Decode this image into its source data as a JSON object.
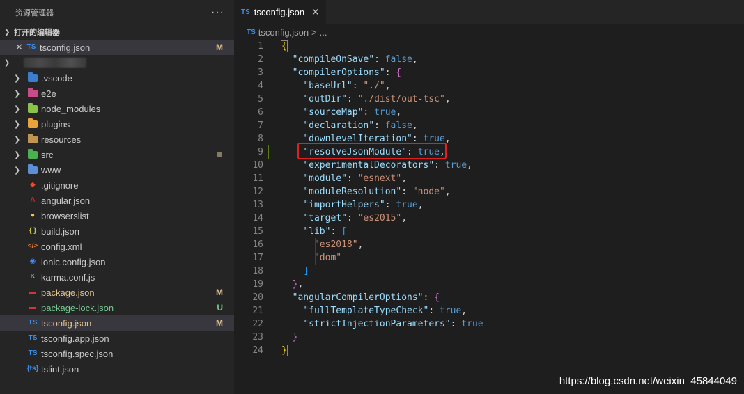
{
  "sidebar": {
    "title": "资源管理器",
    "more": "···",
    "open_editors_title": "打开的编辑器",
    "open_editors": [
      {
        "close": "✕",
        "name": "tsconfig.json",
        "status": "M"
      }
    ],
    "tree": [
      {
        "name": ".vscode",
        "type": "folder",
        "icon_color": "#3c7dd0"
      },
      {
        "name": "e2e",
        "type": "folder",
        "icon_color": "#c94c8a"
      },
      {
        "name": "node_modules",
        "type": "folder",
        "icon_color": "#8bc34a"
      },
      {
        "name": "plugins",
        "type": "folder",
        "icon_color": "#e8a33a"
      },
      {
        "name": "resources",
        "type": "folder",
        "icon_color": "#c09553"
      },
      {
        "name": "src",
        "type": "folder",
        "icon_color": "#4caf50"
      },
      {
        "name": "www",
        "type": "folder",
        "icon_color": "#5c8fd6"
      },
      {
        "name": ".gitignore",
        "type": "file",
        "icon": "git-icon",
        "glyph": "◆",
        "icon_color": "#e44d2e"
      },
      {
        "name": "angular.json",
        "type": "file",
        "icon": "angular-icon",
        "glyph": "A",
        "icon_color": "#dd1b16"
      },
      {
        "name": "browserslist",
        "type": "file",
        "icon": "browserslist-icon",
        "glyph": "●",
        "icon_color": "#f7c948"
      },
      {
        "name": "build.json",
        "type": "file",
        "icon": "json-icon",
        "glyph": "{ }",
        "icon_color": "#cbcb41"
      },
      {
        "name": "config.xml",
        "type": "file",
        "icon": "xml-icon",
        "glyph": "</>",
        "icon_color": "#e37933"
      },
      {
        "name": "ionic.config.json",
        "type": "file",
        "icon": "ionic-icon",
        "glyph": "◉",
        "icon_color": "#4b8bf4"
      },
      {
        "name": "karma.conf.js",
        "type": "file",
        "icon": "karma-icon",
        "glyph": "K",
        "icon_color": "#56c3b6"
      },
      {
        "name": "package.json",
        "type": "file",
        "icon": "npm-icon",
        "glyph": "▬",
        "icon_color": "#cb3837",
        "status": "M"
      },
      {
        "name": "package-lock.json",
        "type": "file",
        "icon": "npm-icon",
        "glyph": "▬",
        "icon_color": "#cb3837",
        "status": "U"
      },
      {
        "name": "tsconfig.json",
        "type": "file",
        "icon": "tsconfig-icon",
        "glyph": "TS",
        "icon_color": "#3b8eea",
        "status": "M",
        "selected": true
      },
      {
        "name": "tsconfig.app.json",
        "type": "file",
        "icon": "tsconfig-icon",
        "glyph": "TS",
        "icon_color": "#3b8eea"
      },
      {
        "name": "tsconfig.spec.json",
        "type": "file",
        "icon": "tsconfig-icon",
        "glyph": "TS",
        "icon_color": "#3b8eea"
      },
      {
        "name": "tslint.json",
        "type": "file",
        "icon": "tslint-icon",
        "glyph": "{ts}",
        "icon_color": "#3b8eea"
      }
    ]
  },
  "editor": {
    "tab": {
      "label": "tsconfig.json",
      "close": "✕",
      "icon": "TS"
    },
    "breadcrumb": {
      "file": "tsconfig.json",
      "sep": ">",
      "rest": "..."
    },
    "lines": [
      {
        "n": "1",
        "t": [
          [
            "br1",
            "{"
          ]
        ]
      },
      {
        "n": "2",
        "t": [
          [
            "p",
            "  "
          ],
          [
            "k",
            "\"compileOnSave\""
          ],
          [
            "p",
            ": "
          ],
          [
            "b",
            "false"
          ],
          [
            "p",
            ","
          ]
        ]
      },
      {
        "n": "3",
        "t": [
          [
            "p",
            "  "
          ],
          [
            "k",
            "\"compilerOptions\""
          ],
          [
            "p",
            ": "
          ],
          [
            "br2",
            "{"
          ]
        ]
      },
      {
        "n": "4",
        "t": [
          [
            "p",
            "    "
          ],
          [
            "k",
            "\"baseUrl\""
          ],
          [
            "p",
            ": "
          ],
          [
            "s",
            "\"./\""
          ],
          [
            "p",
            ","
          ]
        ]
      },
      {
        "n": "5",
        "t": [
          [
            "p",
            "    "
          ],
          [
            "k",
            "\"outDir\""
          ],
          [
            "p",
            ": "
          ],
          [
            "s",
            "\"./dist/out-tsc\""
          ],
          [
            "p",
            ","
          ]
        ]
      },
      {
        "n": "6",
        "t": [
          [
            "p",
            "    "
          ],
          [
            "k",
            "\"sourceMap\""
          ],
          [
            "p",
            ": "
          ],
          [
            "b",
            "true"
          ],
          [
            "p",
            ","
          ]
        ]
      },
      {
        "n": "7",
        "t": [
          [
            "p",
            "    "
          ],
          [
            "k",
            "\"declaration\""
          ],
          [
            "p",
            ": "
          ],
          [
            "b",
            "false"
          ],
          [
            "p",
            ","
          ]
        ]
      },
      {
        "n": "8",
        "t": [
          [
            "p",
            "    "
          ],
          [
            "k",
            "\"downlevelIteration\""
          ],
          [
            "p",
            ": "
          ],
          [
            "b",
            "true"
          ],
          [
            "p",
            ","
          ]
        ]
      },
      {
        "n": "9",
        "t": [
          [
            "p",
            "    "
          ],
          [
            "k",
            "\"resolveJsonModule\""
          ],
          [
            "p",
            ": "
          ],
          [
            "b",
            "true"
          ],
          [
            "p",
            ","
          ]
        ]
      },
      {
        "n": "10",
        "t": [
          [
            "p",
            "    "
          ],
          [
            "k",
            "\"experimentalDecorators\""
          ],
          [
            "p",
            ": "
          ],
          [
            "b",
            "true"
          ],
          [
            "p",
            ","
          ]
        ]
      },
      {
        "n": "11",
        "t": [
          [
            "p",
            "    "
          ],
          [
            "k",
            "\"module\""
          ],
          [
            "p",
            ": "
          ],
          [
            "s",
            "\"esnext\""
          ],
          [
            "p",
            ","
          ]
        ]
      },
      {
        "n": "12",
        "t": [
          [
            "p",
            "    "
          ],
          [
            "k",
            "\"moduleResolution\""
          ],
          [
            "p",
            ": "
          ],
          [
            "s",
            "\"node\""
          ],
          [
            "p",
            ","
          ]
        ]
      },
      {
        "n": "13",
        "t": [
          [
            "p",
            "    "
          ],
          [
            "k",
            "\"importHelpers\""
          ],
          [
            "p",
            ": "
          ],
          [
            "b",
            "true"
          ],
          [
            "p",
            ","
          ]
        ]
      },
      {
        "n": "14",
        "t": [
          [
            "p",
            "    "
          ],
          [
            "k",
            "\"target\""
          ],
          [
            "p",
            ": "
          ],
          [
            "s",
            "\"es2015\""
          ],
          [
            "p",
            ","
          ]
        ]
      },
      {
        "n": "15",
        "t": [
          [
            "p",
            "    "
          ],
          [
            "k",
            "\"lib\""
          ],
          [
            "p",
            ": "
          ],
          [
            "br3",
            "["
          ]
        ]
      },
      {
        "n": "16",
        "t": [
          [
            "p",
            "      "
          ],
          [
            "s",
            "\"es2018\""
          ],
          [
            "p",
            ","
          ]
        ]
      },
      {
        "n": "17",
        "t": [
          [
            "p",
            "      "
          ],
          [
            "s",
            "\"dom\""
          ]
        ]
      },
      {
        "n": "18",
        "t": [
          [
            "p",
            "    "
          ],
          [
            "br3",
            "]"
          ]
        ]
      },
      {
        "n": "19",
        "t": [
          [
            "p",
            "  "
          ],
          [
            "br2",
            "}"
          ],
          [
            "p",
            ","
          ]
        ]
      },
      {
        "n": "20",
        "t": [
          [
            "p",
            "  "
          ],
          [
            "k",
            "\"angularCompilerOptions\""
          ],
          [
            "p",
            ": "
          ],
          [
            "br2",
            "{"
          ]
        ]
      },
      {
        "n": "21",
        "t": [
          [
            "p",
            "    "
          ],
          [
            "k",
            "\"fullTemplateTypeCheck\""
          ],
          [
            "p",
            ": "
          ],
          [
            "b",
            "true"
          ],
          [
            "p",
            ","
          ]
        ]
      },
      {
        "n": "22",
        "t": [
          [
            "p",
            "    "
          ],
          [
            "k",
            "\"strictInjectionParameters\""
          ],
          [
            "p",
            ": "
          ],
          [
            "b",
            "true"
          ]
        ]
      },
      {
        "n": "23",
        "t": [
          [
            "p",
            "  "
          ],
          [
            "br2",
            "}"
          ]
        ]
      },
      {
        "n": "24",
        "t": [
          [
            "br1",
            "}"
          ]
        ]
      }
    ]
  },
  "watermark": "https://blog.csdn.net/weixin_45844049"
}
